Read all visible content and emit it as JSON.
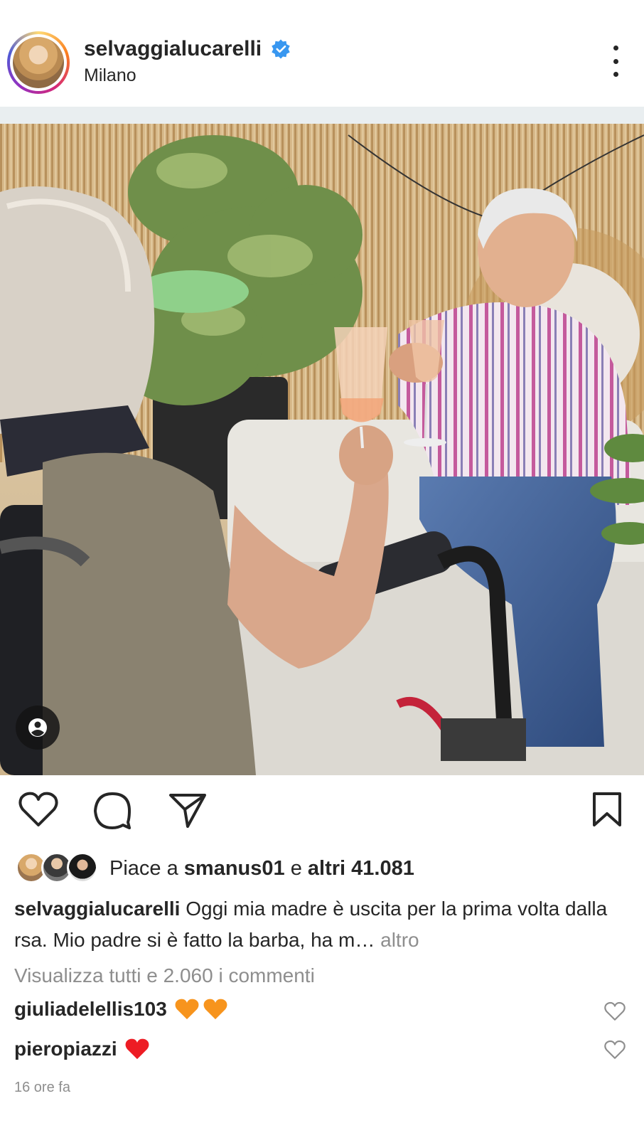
{
  "header": {
    "username": "selvaggialucarelli",
    "verified": true,
    "location": "Milano",
    "icons": {
      "avatar": "avatar",
      "verified": "verified-badge-icon",
      "more": "more-options-icon"
    }
  },
  "post": {
    "photo_alt": "photo",
    "tag_icon": "user-tag-icon"
  },
  "actions": {
    "like_icon": "heart-icon",
    "comment_icon": "comment-icon",
    "share_icon": "send-icon",
    "save_icon": "bookmark-icon"
  },
  "likes": {
    "prefix": "Piace a",
    "user": "smanus01",
    "connector": "e",
    "others": "altri 41.081"
  },
  "caption": {
    "username": "selvaggialucarelli",
    "text": "Oggi mia madre è uscita per la prima volta dalla rsa. Mio padre si è fatto la barba, ha m…",
    "more": "altro"
  },
  "view_all_comments": "Visualizza tutti e 2.060 i commenti",
  "comments": [
    {
      "username": "giuliadelellis103",
      "text": "🧡🧡"
    },
    {
      "username": "pieropiazzi",
      "text": "❤️"
    }
  ],
  "timestamp": "16 ore fa",
  "colors": {
    "verified": "#3897f0",
    "muted": "#8e8e8e",
    "text": "#262626",
    "heart": "#ed1c24",
    "orange_heart": "#f7941d"
  }
}
